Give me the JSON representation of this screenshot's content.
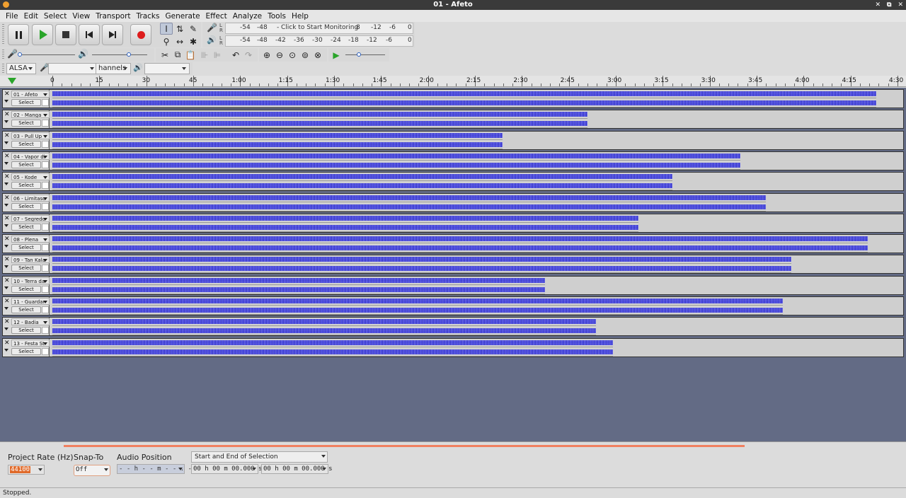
{
  "window": {
    "title": "01 - Afeto"
  },
  "menu": [
    "File",
    "Edit",
    "Select",
    "View",
    "Transport",
    "Tracks",
    "Generate",
    "Effect",
    "Analyze",
    "Tools",
    "Help"
  ],
  "transport": {
    "buttons": [
      "pause",
      "play",
      "stop",
      "skip-to-start",
      "skip-to-end",
      "record"
    ],
    "colors": {
      "play": "#2aa52a",
      "record": "#dd1c1c"
    }
  },
  "meters": {
    "record": {
      "ticks": [
        "-54",
        "-48",
        "-",
        "Click to Start Monitoring",
        "8",
        "-12",
        "-6",
        "0"
      ]
    },
    "playback": {
      "ticks": [
        "-54",
        "-48",
        "-42",
        "-36",
        "-30",
        "-24",
        "-18",
        "-12",
        "-6",
        "0"
      ]
    }
  },
  "device": {
    "host": "ALSA",
    "channels": "hannels"
  },
  "ruler": {
    "labels": [
      "0",
      "15",
      "30",
      "45",
      "1:00",
      "1:15",
      "1:30",
      "1:45",
      "2:00",
      "2:15",
      "2:30",
      "2:45",
      "3:00",
      "3:15",
      "3:30",
      "3:45",
      "4:00",
      "4:15",
      "4:30"
    ]
  },
  "tracks": [
    {
      "name": "01 - Afeto",
      "select": "Select",
      "duration_fraction": 0.97
    },
    {
      "name": "02 - Manga",
      "select": "Select",
      "duration_fraction": 0.63
    },
    {
      "name": "03 - Pull Up",
      "select": "Select",
      "duration_fraction": 0.53
    },
    {
      "name": "04 - Vapor di",
      "select": "Select",
      "duration_fraction": 0.81
    },
    {
      "name": "05 - Kode",
      "select": "Select",
      "duration_fraction": 0.73
    },
    {
      "name": "06 - Limitaso",
      "select": "Select",
      "duration_fraction": 0.84
    },
    {
      "name": "07 - Segredo",
      "select": "Select",
      "duration_fraction": 0.69
    },
    {
      "name": "08 - Plena",
      "select": "Select",
      "duration_fraction": 0.96
    },
    {
      "name": "09 - Tan Kala",
      "select": "Select",
      "duration_fraction": 0.87
    },
    {
      "name": "10 - Terra da",
      "select": "Select",
      "duration_fraction": 0.58
    },
    {
      "name": "11 - Guardar",
      "select": "Select",
      "duration_fraction": 0.86
    },
    {
      "name": "12 - Badia",
      "select": "Select",
      "duration_fraction": 0.64
    },
    {
      "name": "13 - Festa St",
      "select": "Select",
      "duration_fraction": 0.66
    }
  ],
  "selection_bar": {
    "project_rate_label": "Project Rate (Hz)",
    "project_rate_value": "44100",
    "snap_to_label": "Snap-To",
    "snap_to_value": "Off",
    "audio_position_label": "Audio Position",
    "audio_position_value": "- - h - - m - - . - - - s",
    "selection_mode": "Start and End of Selection",
    "selection_start": "00 h 00 m 00.000 s",
    "selection_end": "00 h 00 m 00.000 s"
  },
  "status": "Stopped."
}
